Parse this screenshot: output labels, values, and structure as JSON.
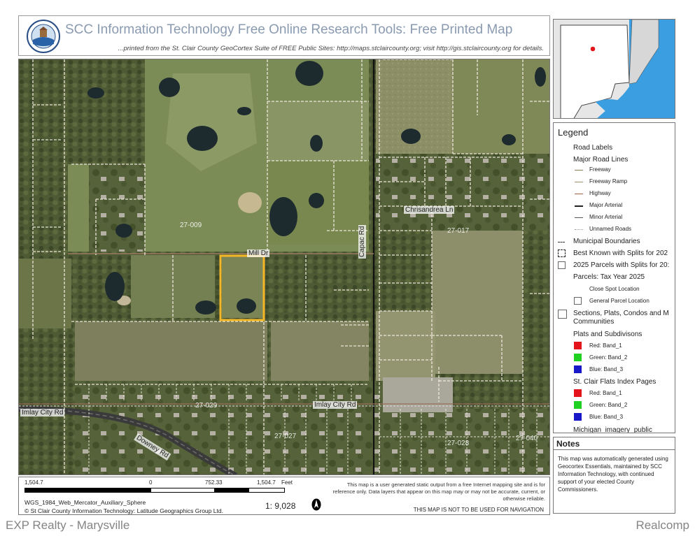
{
  "header": {
    "title": "SCC Information Technology Free Online Research Tools: Free Printed Map",
    "subtitle": "...printed from the St. Clair County GeoCortex Suite of FREE Public Sites: http://maps.stclaircounty.org; visit http://gis.stclaircounty.org for details.",
    "seal_text": "ST. CLAIR COUNTY"
  },
  "map": {
    "road_labels": {
      "chrisandrea": "Chrisandrea Ln",
      "capac": "Capac Rd",
      "mill": "Mill Dr",
      "imlay_center": "Imlay City Rd",
      "imlay_left": "Imlay City Rd",
      "downey": "Downey Rd"
    },
    "parcel_numbers": {
      "a": "27-009",
      "b": "27-017",
      "c": "27-027",
      "d": "27-029",
      "e": "27-028",
      "f": "27-040"
    },
    "selected_parcel_color": "#f4b728",
    "parcel_line_color": "#f2ece0"
  },
  "legend": {
    "title": "Legend",
    "road_labels": "Road Labels",
    "major_road_lines": "Major Road Lines",
    "road_items": [
      {
        "label": "Freeway",
        "color": "#8a7a56"
      },
      {
        "label": "Freeway Ramp",
        "color": "#a09070"
      },
      {
        "label": "Highway",
        "color": "#a0624a"
      },
      {
        "label": "Major Arterial",
        "color": "#222222"
      },
      {
        "label": "Minor Arterial",
        "color": "#555555"
      },
      {
        "label": "Unnamed Roads",
        "color": "#999999"
      }
    ],
    "municipal_boundaries": "Municipal Boundaries",
    "best_known": "Best Known with Splits for 202",
    "parcels_2025": "2025 Parcels with Splits for 20:",
    "parcels_tax_year": "Parcels: Tax Year 2025",
    "close_spot": "Close Spot Location",
    "general_parcel": "General Parcel Location",
    "sections": "Sections, Plats, Condos and M",
    "communities": "Communities",
    "plats": "Plats and Subdivisons",
    "bands_1": [
      {
        "label": "Red:  Band_1",
        "color": "#e3141c"
      },
      {
        "label": "Green:  Band_2",
        "color": "#21d121"
      },
      {
        "label": "Blue:  Band_3",
        "color": "#1818c8"
      }
    ],
    "flats_index": "St. Clair Flats Index Pages",
    "bands_2": [
      {
        "label": "Red:  Band_1",
        "color": "#e3141c"
      },
      {
        "label": "Green:  Band_2",
        "color": "#21d121"
      },
      {
        "label": "Blue:  Band_3",
        "color": "#1818c8"
      }
    ],
    "michigan_imagery": "Michigan_imagery_public"
  },
  "notes": {
    "title": "Notes",
    "body": "This map was automatically generated using Geocortex Essentials, maintained by SCC Information Technology, with continued support of your elected County Commissioners."
  },
  "footer": {
    "scale_left": "1,504.7",
    "scale_zero": "0",
    "scale_mid": "752.33",
    "scale_right": "1,504.7",
    "scale_unit": "Feet",
    "projection": "WGS_1984_Web_Mercator_Auxiliary_Sphere",
    "copyright": "© St Clair County Information Technology: Latitude Geographics Group Ltd.",
    "scale_ratio": "1: 9,028",
    "disclaimer": "This map is a user generated static output from a free Internet mapping site and is for reference only. Data layers that appear on this map may or may not be accurate, current, or otherwise reliable.",
    "nav_warning": "THIS MAP IS NOT TO BE USED FOR NAVIGATION"
  },
  "watermarks": {
    "left": "EXP Realty - Marysville",
    "right": "Realcomp"
  }
}
